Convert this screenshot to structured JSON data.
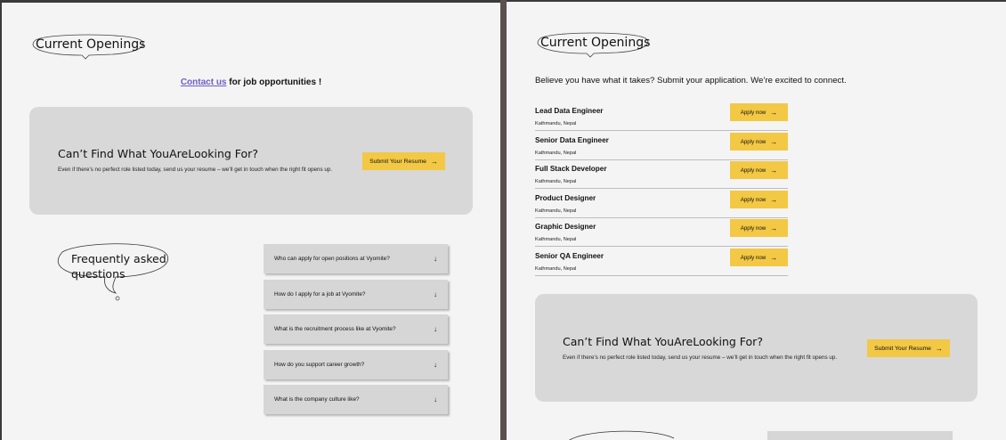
{
  "left": {
    "heading": "Current Openings",
    "contact": {
      "link": "Contact us",
      "suffix": " for job opportunities !"
    },
    "cta": {
      "title": "Can’t Find What YouAreLooking For?",
      "description": "Even if there’s no perfect role listed today, send us your resume – we’ll get in touch when the right fit opens up.",
      "button": "Submit Your Resume",
      "button_arrow": "→"
    },
    "faq": {
      "title": "Frequently asked questions",
      "items": [
        {
          "question": "Who can apply for open positions at Vyomite?",
          "arrow": "↓"
        },
        {
          "question": "How do I apply for a job at Vyomite?",
          "arrow": "↓"
        },
        {
          "question": "What is the recruitment process like at Vyomite?",
          "arrow": "↓"
        },
        {
          "question": "How do you support career growth?",
          "arrow": "↓"
        },
        {
          "question": "What is the company culture like?",
          "arrow": "↓"
        }
      ]
    }
  },
  "right": {
    "heading": "Current Openings",
    "intro": "Believe you have what it takes? Submit your application. We’re excited to connect.",
    "jobs": [
      {
        "title": "Lead Data Engineer",
        "location": "Kathmandu, Nepal",
        "button": "Apply now",
        "arrow": "→"
      },
      {
        "title": "Senior Data Engineer",
        "location": "Kathmandu, Nepal",
        "button": "Apply now",
        "arrow": "→"
      },
      {
        "title": "Full Stack Developer",
        "location": "Kathmandu, Nepal",
        "button": "Apply now",
        "arrow": "→"
      },
      {
        "title": "Product Designer",
        "location": "Kathmandu, Nepal",
        "button": "Apply now",
        "arrow": "→"
      },
      {
        "title": "Graphic Designer",
        "location": "Kathmandu, Nepal",
        "button": "Apply now",
        "arrow": "→"
      },
      {
        "title": "Senior QA Engineer",
        "location": "Kathmandu, Nepal",
        "button": "Apply now",
        "arrow": "→"
      }
    ],
    "cta": {
      "title": "Can’t Find What YouAreLooking For?",
      "description": "Even if there’s no perfect role listed today, send us your resume – we’ll get in touch when the right fit opens up.",
      "button": "Submit Your Resume",
      "button_arrow": "→"
    }
  },
  "colors": {
    "accent_yellow": "#f3c845",
    "link_purple": "#6b5fc7",
    "card_gray": "#d8d8d8",
    "page_bg": "#f4f4f4"
  }
}
